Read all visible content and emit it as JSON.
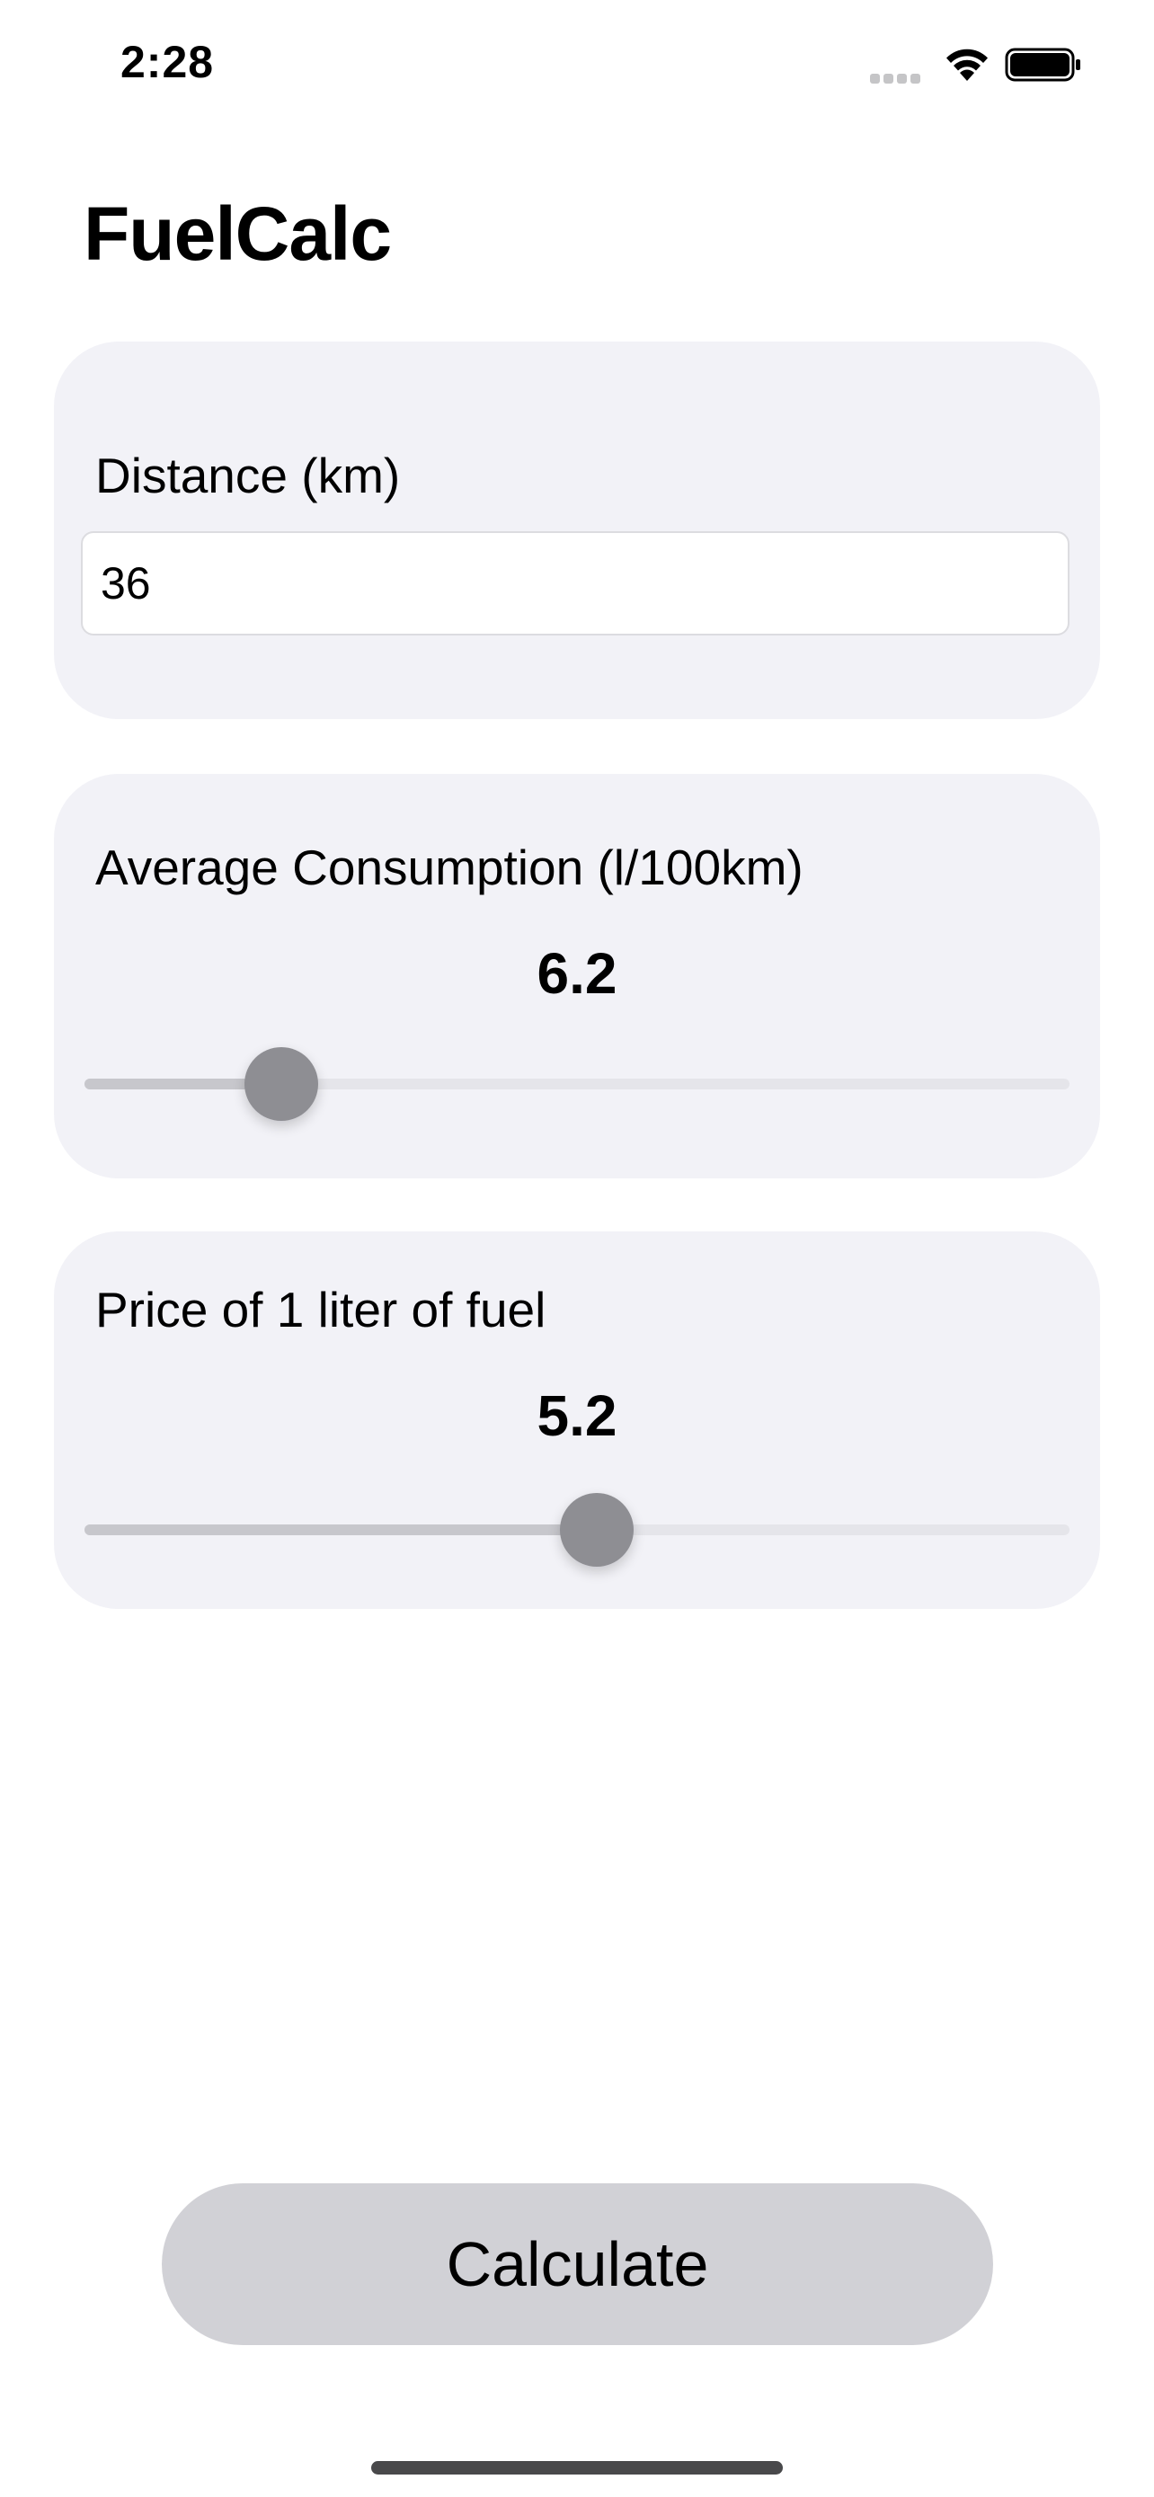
{
  "status_bar": {
    "time": "2:28",
    "icons": [
      "cellular-signal-icon",
      "wifi-icon",
      "battery-icon"
    ]
  },
  "app": {
    "title": "FuelCalc"
  },
  "distance": {
    "label": "Distance (km)",
    "value": "36"
  },
  "consumption": {
    "label": "Average Consumption (l/100km)",
    "value_text": "6.2",
    "slider_fraction": 0.2
  },
  "price": {
    "label": "Price of 1 liter of fuel",
    "value_text": "5.2",
    "slider_fraction": 0.52
  },
  "calculate_button": {
    "label": "Calculate"
  },
  "colors": {
    "card_background": "#f2f2f7",
    "slider_thumb": "#8e8e93",
    "button_background": "#d1d1d6"
  }
}
